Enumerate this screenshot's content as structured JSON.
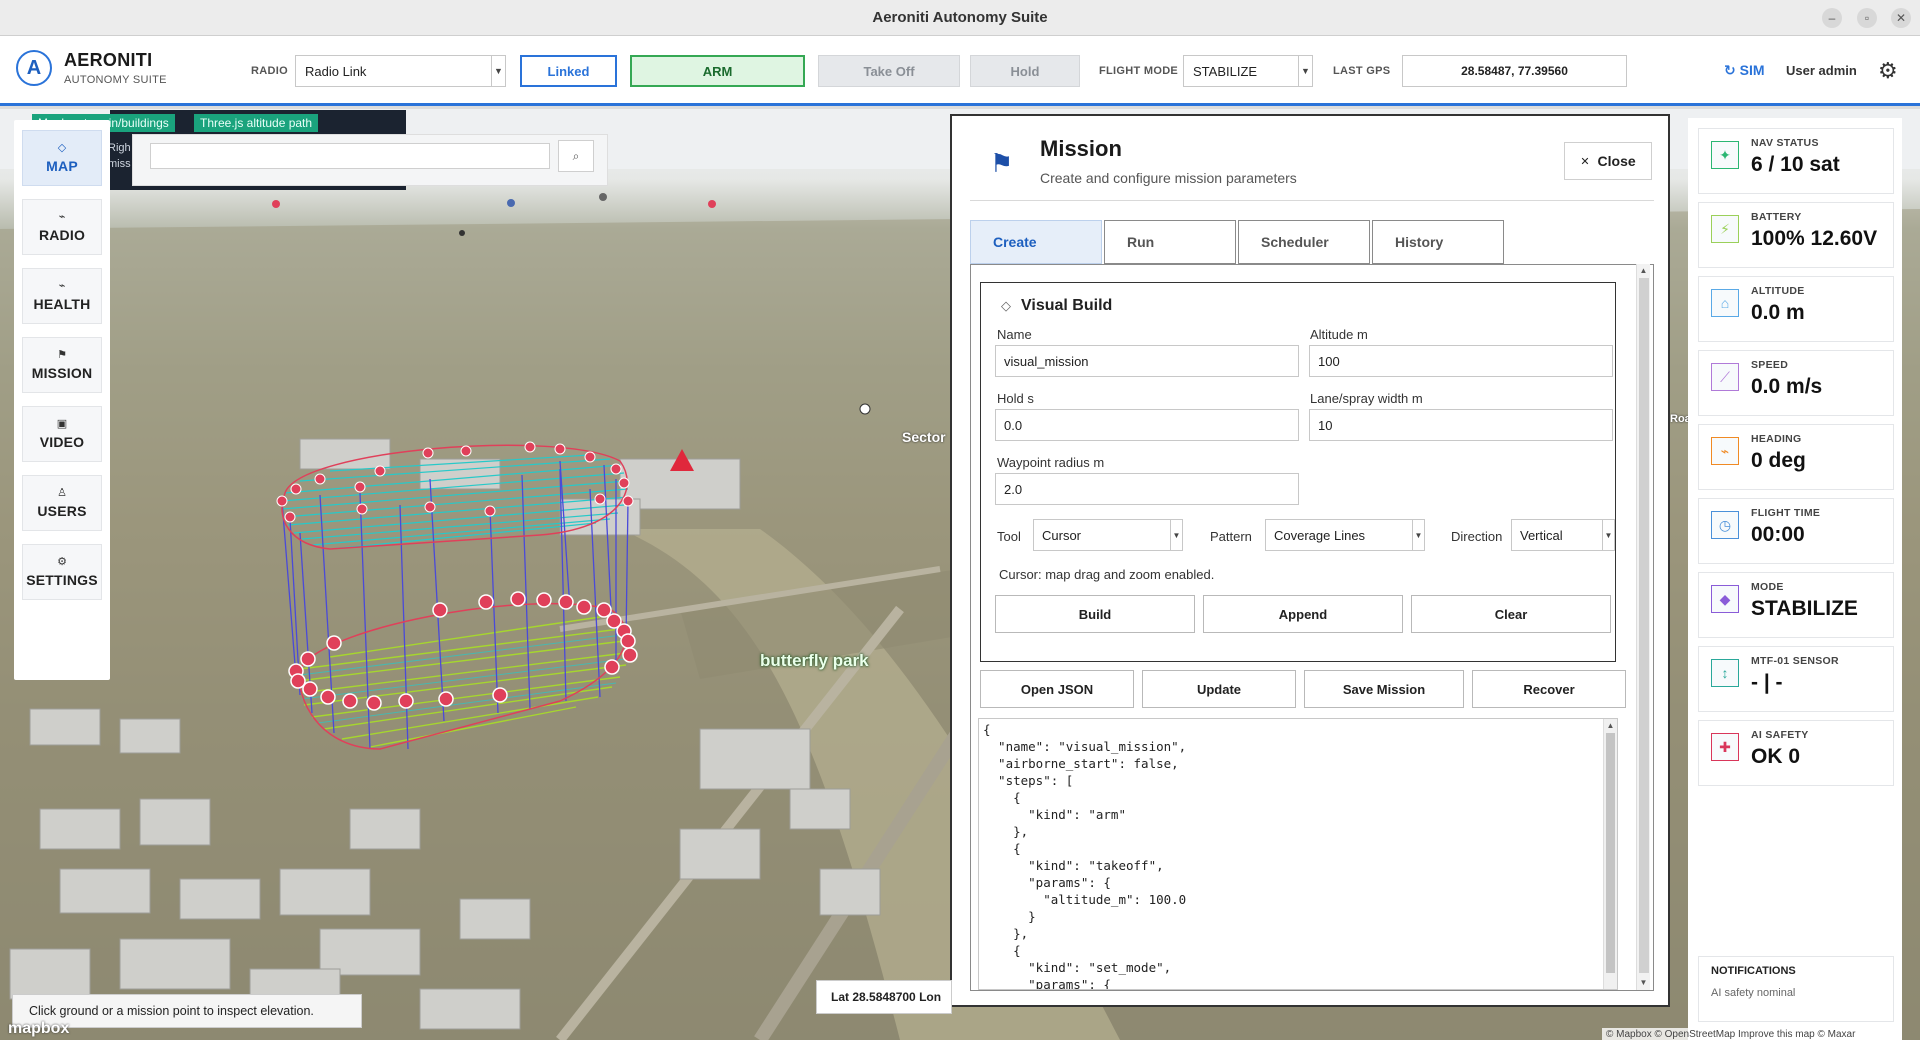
{
  "window": {
    "title": "Aeroniti Autonomy Suite"
  },
  "header": {
    "brand": "AERONITI",
    "brand_sub": "AUTONOMY SUITE",
    "radio_label": "RADIO",
    "radio_value": "Radio Link",
    "linked": "Linked",
    "arm": "ARM",
    "takeoff": "Take Off",
    "hold": "Hold",
    "flight_mode_label": "FLIGHT MODE",
    "flight_mode_value": "STABILIZE",
    "last_gps_label": "LAST GPS",
    "last_gps_value": "28.58487, 77.39560",
    "sim": "↻ SIM",
    "user": "User admin"
  },
  "nav": [
    {
      "icon": "◇",
      "label": "MAP",
      "active": true
    },
    {
      "icon": "⌁",
      "label": "RADIO"
    },
    {
      "icon": "⌁",
      "label": "HEALTH"
    },
    {
      "icon": "⚑",
      "label": "MISSION"
    },
    {
      "icon": "▣",
      "label": "VIDEO"
    },
    {
      "icon": "♙",
      "label": "USERS"
    },
    {
      "icon": "⚙",
      "label": "SETTINGS"
    }
  ],
  "map": {
    "chips": [
      "Mapbox terrain/buildings",
      "Three.js altitude path"
    ],
    "info_fragment": "Righ\nmiss",
    "search_placeholder": "",
    "labels": {
      "park": "butterfly park",
      "sector": "Sector",
      "road": "Roa"
    },
    "elev_hint": "Click ground or a mission point to inspect elevation.",
    "latlon": "Lat 28.5848700  Lon",
    "brand": "mapbox",
    "attribution": "© Mapbox © OpenStreetMap  Improve this map  © Maxar"
  },
  "mission": {
    "title": "Mission",
    "subtitle": "Create and configure mission parameters",
    "close": "Close",
    "tabs": [
      "Create",
      "Run",
      "Scheduler",
      "History"
    ],
    "active_tab": "Create",
    "visual_build": {
      "title": "Visual Build",
      "name_label": "Name",
      "name_value": "visual_mission",
      "altitude_label": "Altitude m",
      "altitude_value": "100",
      "hold_label": "Hold s",
      "hold_value": "0.0",
      "lane_label": "Lane/spray width m",
      "lane_value": "10",
      "radius_label": "Waypoint radius m",
      "radius_value": "2.0",
      "tool_label": "Tool",
      "tool_value": "Cursor",
      "pattern_label": "Pattern",
      "pattern_value": "Coverage Lines",
      "direction_label": "Direction",
      "direction_value": "Vertical",
      "hint": "Cursor: map drag and zoom enabled.",
      "build": "Build",
      "append": "Append",
      "clear": "Clear"
    },
    "actions": [
      "Open JSON",
      "Update",
      "Save Mission",
      "Recover"
    ],
    "json": "{\n  \"name\": \"visual_mission\",\n  \"airborne_start\": false,\n  \"steps\": [\n    {\n      \"kind\": \"arm\"\n    },\n    {\n      \"kind\": \"takeoff\",\n      \"params\": {\n        \"altitude_m\": 100.0\n      }\n    },\n    {\n      \"kind\": \"set_mode\",\n      \"params\": {"
  },
  "telemetry": [
    {
      "label": "NAV STATUS",
      "value": "6 / 10 sat",
      "icon": "✦",
      "color": "#2bb673"
    },
    {
      "label": "BATTERY",
      "value": "100% 12.60V",
      "icon": "⚡",
      "color": "#9bd05a"
    },
    {
      "label": "ALTITUDE",
      "value": "0.0 m",
      "icon": "⌂",
      "color": "#5aa9e6"
    },
    {
      "label": "SPEED",
      "value": "0.0 m/s",
      "icon": "⟋",
      "color": "#b07ad8"
    },
    {
      "label": "HEADING",
      "value": "0 deg",
      "icon": "⌁",
      "color": "#f08a24"
    },
    {
      "label": "FLIGHT TIME",
      "value": "00:00",
      "icon": "◷",
      "color": "#4a90d9"
    },
    {
      "label": "MODE",
      "value": "STABILIZE",
      "icon": "◆",
      "color": "#8a5cd8"
    },
    {
      "label": "MTF-01 SENSOR",
      "value": "- | -",
      "icon": "↕",
      "color": "#2aa89a"
    },
    {
      "label": "AI SAFETY",
      "value": "OK 0",
      "icon": "✚",
      "color": "#d9365a"
    }
  ],
  "notifications": {
    "title": "NOTIFICATIONS",
    "message": "AI safety nominal"
  },
  "colors": {
    "accent": "#2a73d9",
    "path_cyan": "#27c9c9",
    "waypoint": "#e0405a",
    "path_blue": "#4a4ad8",
    "ground_path": "#a6d62e"
  }
}
